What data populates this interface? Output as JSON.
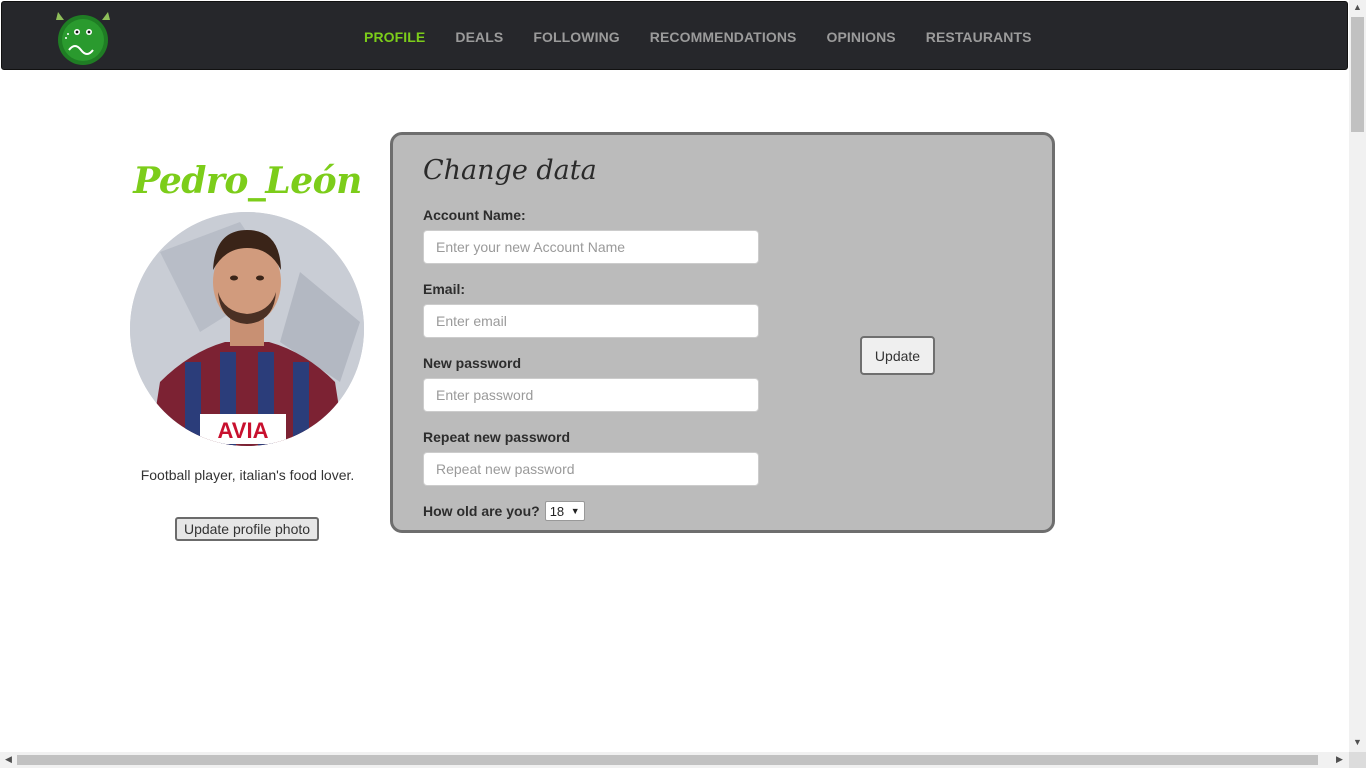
{
  "nav": {
    "links": [
      "PROFILE",
      "DEALS",
      "FOLLOWING",
      "RECOMMENDATIONS",
      "OPINIONS",
      "RESTAURANTS"
    ],
    "active_index": 0
  },
  "profile": {
    "username": "Pedro_León",
    "bio": "Football player, italian's food lover.",
    "update_photo_label": "Update profile photo",
    "shirt_text": "AVIA"
  },
  "form": {
    "title": "Change data",
    "account_label": "Account Name:",
    "account_placeholder": "Enter your new Account Name",
    "email_label": "Email:",
    "email_placeholder": "Enter email",
    "password_label": "New password",
    "password_placeholder": "Enter password",
    "repeat_label": "Repeat new password",
    "repeat_placeholder": "Repeat new password",
    "age_label": "How old are you?",
    "age_value": "18",
    "update_label": "Update"
  },
  "colors": {
    "accent": "#7ccd1a",
    "navbar": "#26272b",
    "panel": "#bbbbbb"
  }
}
